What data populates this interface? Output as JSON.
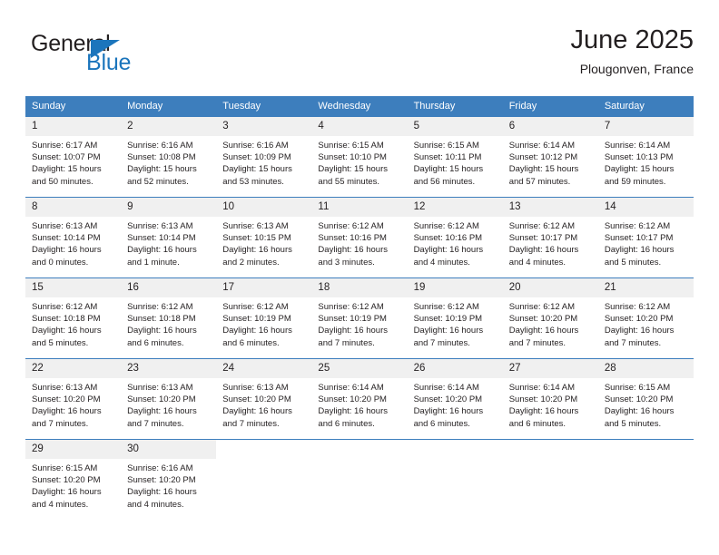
{
  "logo": {
    "word_top": "General",
    "word_bottom": "Blue",
    "triangle_color": "#1b75bc"
  },
  "header": {
    "title": "June 2025",
    "subtitle": "Plougonven, France"
  },
  "theme": {
    "header_blue": "#3d7ebd",
    "daynum_band": "#f0f0f0",
    "text": "#231f20"
  },
  "calendar": {
    "weekday_headers": [
      "Sunday",
      "Monday",
      "Tuesday",
      "Wednesday",
      "Thursday",
      "Friday",
      "Saturday"
    ],
    "weeks": [
      [
        {
          "day": "1",
          "sunrise": "Sunrise: 6:17 AM",
          "sunset": "Sunset: 10:07 PM",
          "daylight_line1": "Daylight: 15 hours",
          "daylight_line2": "and 50 minutes."
        },
        {
          "day": "2",
          "sunrise": "Sunrise: 6:16 AM",
          "sunset": "Sunset: 10:08 PM",
          "daylight_line1": "Daylight: 15 hours",
          "daylight_line2": "and 52 minutes."
        },
        {
          "day": "3",
          "sunrise": "Sunrise: 6:16 AM",
          "sunset": "Sunset: 10:09 PM",
          "daylight_line1": "Daylight: 15 hours",
          "daylight_line2": "and 53 minutes."
        },
        {
          "day": "4",
          "sunrise": "Sunrise: 6:15 AM",
          "sunset": "Sunset: 10:10 PM",
          "daylight_line1": "Daylight: 15 hours",
          "daylight_line2": "and 55 minutes."
        },
        {
          "day": "5",
          "sunrise": "Sunrise: 6:15 AM",
          "sunset": "Sunset: 10:11 PM",
          "daylight_line1": "Daylight: 15 hours",
          "daylight_line2": "and 56 minutes."
        },
        {
          "day": "6",
          "sunrise": "Sunrise: 6:14 AM",
          "sunset": "Sunset: 10:12 PM",
          "daylight_line1": "Daylight: 15 hours",
          "daylight_line2": "and 57 minutes."
        },
        {
          "day": "7",
          "sunrise": "Sunrise: 6:14 AM",
          "sunset": "Sunset: 10:13 PM",
          "daylight_line1": "Daylight: 15 hours",
          "daylight_line2": "and 59 minutes."
        }
      ],
      [
        {
          "day": "8",
          "sunrise": "Sunrise: 6:13 AM",
          "sunset": "Sunset: 10:14 PM",
          "daylight_line1": "Daylight: 16 hours",
          "daylight_line2": "and 0 minutes."
        },
        {
          "day": "9",
          "sunrise": "Sunrise: 6:13 AM",
          "sunset": "Sunset: 10:14 PM",
          "daylight_line1": "Daylight: 16 hours",
          "daylight_line2": "and 1 minute."
        },
        {
          "day": "10",
          "sunrise": "Sunrise: 6:13 AM",
          "sunset": "Sunset: 10:15 PM",
          "daylight_line1": "Daylight: 16 hours",
          "daylight_line2": "and 2 minutes."
        },
        {
          "day": "11",
          "sunrise": "Sunrise: 6:12 AM",
          "sunset": "Sunset: 10:16 PM",
          "daylight_line1": "Daylight: 16 hours",
          "daylight_line2": "and 3 minutes."
        },
        {
          "day": "12",
          "sunrise": "Sunrise: 6:12 AM",
          "sunset": "Sunset: 10:16 PM",
          "daylight_line1": "Daylight: 16 hours",
          "daylight_line2": "and 4 minutes."
        },
        {
          "day": "13",
          "sunrise": "Sunrise: 6:12 AM",
          "sunset": "Sunset: 10:17 PM",
          "daylight_line1": "Daylight: 16 hours",
          "daylight_line2": "and 4 minutes."
        },
        {
          "day": "14",
          "sunrise": "Sunrise: 6:12 AM",
          "sunset": "Sunset: 10:17 PM",
          "daylight_line1": "Daylight: 16 hours",
          "daylight_line2": "and 5 minutes."
        }
      ],
      [
        {
          "day": "15",
          "sunrise": "Sunrise: 6:12 AM",
          "sunset": "Sunset: 10:18 PM",
          "daylight_line1": "Daylight: 16 hours",
          "daylight_line2": "and 5 minutes."
        },
        {
          "day": "16",
          "sunrise": "Sunrise: 6:12 AM",
          "sunset": "Sunset: 10:18 PM",
          "daylight_line1": "Daylight: 16 hours",
          "daylight_line2": "and 6 minutes."
        },
        {
          "day": "17",
          "sunrise": "Sunrise: 6:12 AM",
          "sunset": "Sunset: 10:19 PM",
          "daylight_line1": "Daylight: 16 hours",
          "daylight_line2": "and 6 minutes."
        },
        {
          "day": "18",
          "sunrise": "Sunrise: 6:12 AM",
          "sunset": "Sunset: 10:19 PM",
          "daylight_line1": "Daylight: 16 hours",
          "daylight_line2": "and 7 minutes."
        },
        {
          "day": "19",
          "sunrise": "Sunrise: 6:12 AM",
          "sunset": "Sunset: 10:19 PM",
          "daylight_line1": "Daylight: 16 hours",
          "daylight_line2": "and 7 minutes."
        },
        {
          "day": "20",
          "sunrise": "Sunrise: 6:12 AM",
          "sunset": "Sunset: 10:20 PM",
          "daylight_line1": "Daylight: 16 hours",
          "daylight_line2": "and 7 minutes."
        },
        {
          "day": "21",
          "sunrise": "Sunrise: 6:12 AM",
          "sunset": "Sunset: 10:20 PM",
          "daylight_line1": "Daylight: 16 hours",
          "daylight_line2": "and 7 minutes."
        }
      ],
      [
        {
          "day": "22",
          "sunrise": "Sunrise: 6:13 AM",
          "sunset": "Sunset: 10:20 PM",
          "daylight_line1": "Daylight: 16 hours",
          "daylight_line2": "and 7 minutes."
        },
        {
          "day": "23",
          "sunrise": "Sunrise: 6:13 AM",
          "sunset": "Sunset: 10:20 PM",
          "daylight_line1": "Daylight: 16 hours",
          "daylight_line2": "and 7 minutes."
        },
        {
          "day": "24",
          "sunrise": "Sunrise: 6:13 AM",
          "sunset": "Sunset: 10:20 PM",
          "daylight_line1": "Daylight: 16 hours",
          "daylight_line2": "and 7 minutes."
        },
        {
          "day": "25",
          "sunrise": "Sunrise: 6:14 AM",
          "sunset": "Sunset: 10:20 PM",
          "daylight_line1": "Daylight: 16 hours",
          "daylight_line2": "and 6 minutes."
        },
        {
          "day": "26",
          "sunrise": "Sunrise: 6:14 AM",
          "sunset": "Sunset: 10:20 PM",
          "daylight_line1": "Daylight: 16 hours",
          "daylight_line2": "and 6 minutes."
        },
        {
          "day": "27",
          "sunrise": "Sunrise: 6:14 AM",
          "sunset": "Sunset: 10:20 PM",
          "daylight_line1": "Daylight: 16 hours",
          "daylight_line2": "and 6 minutes."
        },
        {
          "day": "28",
          "sunrise": "Sunrise: 6:15 AM",
          "sunset": "Sunset: 10:20 PM",
          "daylight_line1": "Daylight: 16 hours",
          "daylight_line2": "and 5 minutes."
        }
      ],
      [
        {
          "day": "29",
          "sunrise": "Sunrise: 6:15 AM",
          "sunset": "Sunset: 10:20 PM",
          "daylight_line1": "Daylight: 16 hours",
          "daylight_line2": "and 4 minutes."
        },
        {
          "day": "30",
          "sunrise": "Sunrise: 6:16 AM",
          "sunset": "Sunset: 10:20 PM",
          "daylight_line1": "Daylight: 16 hours",
          "daylight_line2": "and 4 minutes."
        },
        {
          "day": "",
          "sunrise": "",
          "sunset": "",
          "daylight_line1": "",
          "daylight_line2": ""
        },
        {
          "day": "",
          "sunrise": "",
          "sunset": "",
          "daylight_line1": "",
          "daylight_line2": ""
        },
        {
          "day": "",
          "sunrise": "",
          "sunset": "",
          "daylight_line1": "",
          "daylight_line2": ""
        },
        {
          "day": "",
          "sunrise": "",
          "sunset": "",
          "daylight_line1": "",
          "daylight_line2": ""
        },
        {
          "day": "",
          "sunrise": "",
          "sunset": "",
          "daylight_line1": "",
          "daylight_line2": ""
        }
      ]
    ]
  }
}
